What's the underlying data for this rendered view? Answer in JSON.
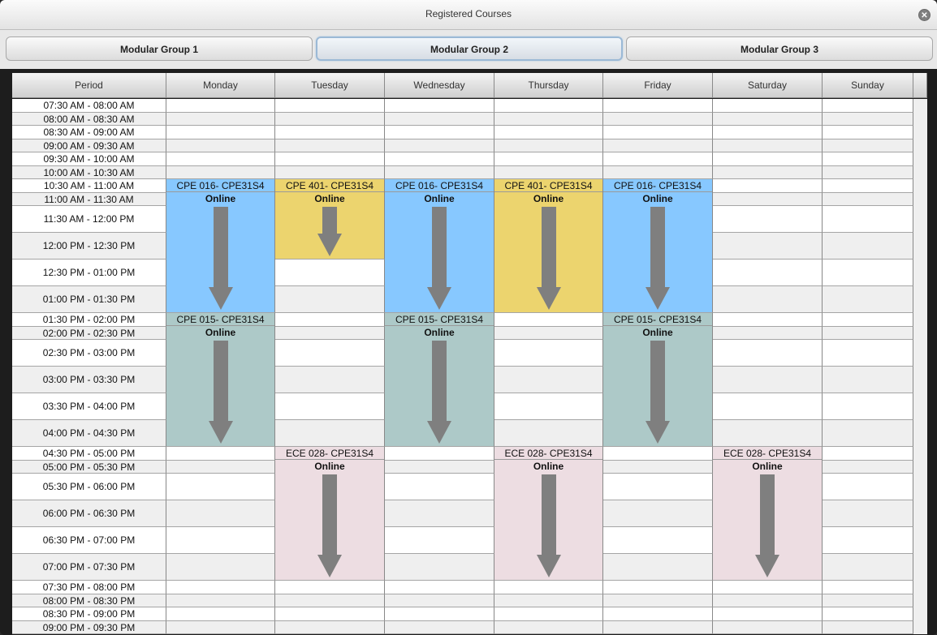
{
  "window": {
    "title": "Registered Courses"
  },
  "tabs": [
    {
      "label": "Modular Group 1",
      "active": false
    },
    {
      "label": "Modular Group 2",
      "active": true
    },
    {
      "label": "Modular Group 3",
      "active": false
    }
  ],
  "columns": [
    "Period",
    "Monday",
    "Tuesday",
    "Wednesday",
    "Thursday",
    "Friday",
    "Saturday",
    "Sunday"
  ],
  "periods": [
    "07:30 AM - 08:00 AM",
    "08:00 AM - 08:30 AM",
    "08:30 AM - 09:00 AM",
    "09:00 AM - 09:30 AM",
    "09:30 AM - 10:00 AM",
    "10:00 AM - 10:30 AM",
    "10:30 AM - 11:00 AM",
    "11:00 AM - 11:30 AM",
    "11:30 AM - 12:00 PM",
    "12:00 PM - 12:30 PM",
    "12:30 PM - 01:00 PM",
    "01:00 PM - 01:30 PM",
    "01:30 PM - 02:00 PM",
    "02:00 PM - 02:30 PM",
    "02:30 PM - 03:00 PM",
    "03:00 PM - 03:30 PM",
    "03:30 PM - 04:00 PM",
    "04:00 PM - 04:30 PM",
    "04:30 PM - 05:00 PM",
    "05:00 PM - 05:30 PM",
    "05:30 PM - 06:00 PM",
    "06:00 PM - 06:30 PM",
    "06:30 PM - 07:00 PM",
    "07:00 PM - 07:30 PM",
    "07:30 PM - 08:00 PM",
    "08:00 PM - 08:30 PM",
    "08:30 PM - 09:00 PM",
    "09:00 PM - 09:30 PM"
  ],
  "courses": [
    {
      "day": 0,
      "start": 6,
      "end": 11,
      "code": "CPE 016- CPE31S4",
      "mode": "Online",
      "color": "#87c8ff"
    },
    {
      "day": 1,
      "start": 6,
      "end": 9,
      "code": "CPE 401- CPE31S4",
      "mode": "Online",
      "color": "#ecd46e"
    },
    {
      "day": 2,
      "start": 6,
      "end": 11,
      "code": "CPE 016- CPE31S4",
      "mode": "Online",
      "color": "#87c8ff"
    },
    {
      "day": 3,
      "start": 6,
      "end": 11,
      "code": "CPE 401- CPE31S4",
      "mode": "Online",
      "color": "#ecd46e"
    },
    {
      "day": 4,
      "start": 6,
      "end": 11,
      "code": "CPE 016- CPE31S4",
      "mode": "Online",
      "color": "#87c8ff"
    },
    {
      "day": 0,
      "start": 12,
      "end": 17,
      "code": "CPE 015- CPE31S4",
      "mode": "Online",
      "color": "#adc9c8"
    },
    {
      "day": 2,
      "start": 12,
      "end": 17,
      "code": "CPE 015- CPE31S4",
      "mode": "Online",
      "color": "#adc9c8"
    },
    {
      "day": 4,
      "start": 12,
      "end": 17,
      "code": "CPE 015- CPE31S4",
      "mode": "Online",
      "color": "#adc9c8"
    },
    {
      "day": 1,
      "start": 18,
      "end": 23,
      "code": "ECE 028- CPE31S4",
      "mode": "Online",
      "color": "#eddde2"
    },
    {
      "day": 3,
      "start": 18,
      "end": 23,
      "code": "ECE 028- CPE31S4",
      "mode": "Online",
      "color": "#eddde2"
    },
    {
      "day": 5,
      "start": 18,
      "end": 23,
      "code": "ECE 028- CPE31S4",
      "mode": "Online",
      "color": "#eddde2"
    }
  ],
  "icons": {
    "close": "close-icon",
    "arrow": "arrow-down-icon"
  }
}
